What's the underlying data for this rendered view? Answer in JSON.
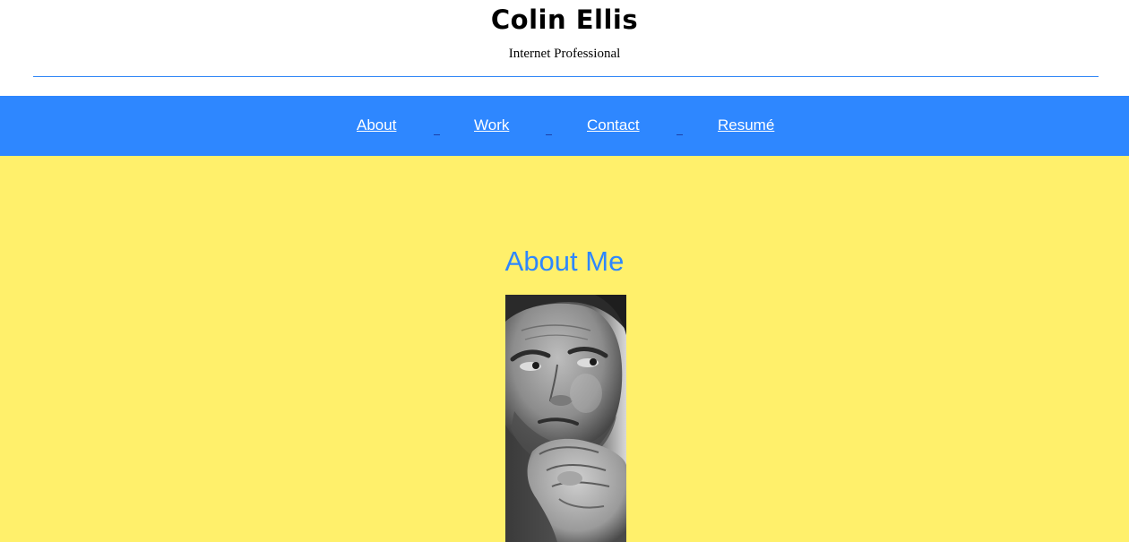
{
  "header": {
    "title": "Colin Ellis",
    "subtitle": "Internet Professional"
  },
  "nav": {
    "items": [
      {
        "label": "About"
      },
      {
        "label": "Work"
      },
      {
        "label": "Contact"
      },
      {
        "label": "Resumé"
      }
    ]
  },
  "about": {
    "heading": "About Me",
    "portrait_alt": "Black and white photo of a man with his hand on his chin"
  },
  "colors": {
    "nav_background": "#2e87ff",
    "section_background": "#fff06b",
    "accent": "#2e87ff",
    "header_rule": "#2f86f6"
  }
}
